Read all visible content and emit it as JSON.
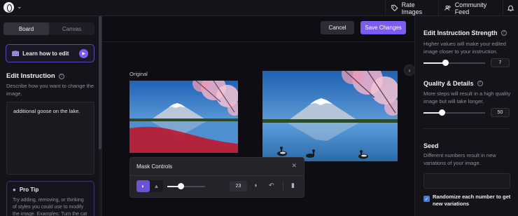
{
  "topbar": {
    "rate_images": "Rate Images",
    "community_feed": "Community Feed"
  },
  "left": {
    "tabs": [
      {
        "label": "Board"
      },
      {
        "label": "Canvas"
      }
    ],
    "learn_label": "Learn how to edit",
    "edit_title": "Edit Instruction",
    "edit_desc": "Describe how you want to change the image.",
    "edit_value": "additional goose on the lake.",
    "protip_title": "Pro Tip",
    "protip_text": "Try adding, removing, or thinking of styles you could use to modify the image. Examples: Turn the cat"
  },
  "center": {
    "cancel_label": "Cancel",
    "save_label": "Save Changes",
    "original_label": "Original"
  },
  "mask": {
    "title": "Mask Controls",
    "brush_size": "23",
    "brush_fraction": 0.35
  },
  "right": {
    "strength_title": "Edit Instruction Strength",
    "strength_desc": "Higher values will make your edited image closer to your instruction.",
    "strength_value": "7",
    "strength_fraction": 0.35,
    "quality_title": "Quality & Details",
    "quality_desc": "More steps will result in a high quality image but will take longer.",
    "quality_value": "50",
    "quality_fraction": 0.3,
    "seed_title": "Seed",
    "seed_desc": "Different numbers result in new variations of your image.",
    "seed_value": "",
    "randomize_label": "Randomize each number to get new variations",
    "randomize_checked": true
  },
  "colors": {
    "accent": "#7c5cf0",
    "checkbox": "#3c7be8",
    "mask": "#c0142a"
  }
}
